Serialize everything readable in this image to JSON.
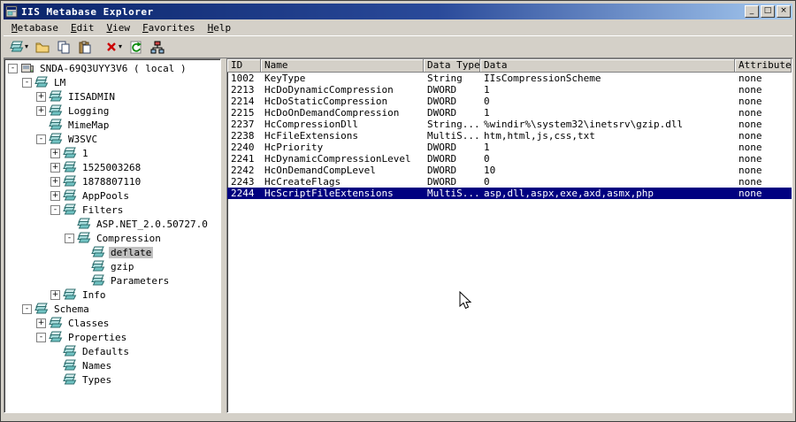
{
  "window": {
    "title": "IIS Metabase Explorer",
    "controls": {
      "minimize": "_",
      "maximize": "□",
      "close": "×"
    }
  },
  "menu": {
    "items": [
      "Metabase",
      "Edit",
      "View",
      "Favorites",
      "Help"
    ]
  },
  "toolbar": {
    "dropdown_glyph": "▾",
    "buttons": [
      "new-key",
      "open",
      "copy",
      "paste",
      "delete",
      "refresh",
      "network"
    ]
  },
  "tree": {
    "items": [
      {
        "label": "SNDA-69Q3UYY3V6 ( local )",
        "depth": 0,
        "expand": "minus",
        "icon": "server",
        "selected": false
      },
      {
        "label": "LM",
        "depth": 1,
        "expand": "minus",
        "icon": "keys",
        "selected": false
      },
      {
        "label": "IISADMIN",
        "depth": 2,
        "expand": "plus",
        "icon": "keys",
        "selected": false
      },
      {
        "label": "Logging",
        "depth": 2,
        "expand": "plus",
        "icon": "keys",
        "selected": false
      },
      {
        "label": "MimeMap",
        "depth": 2,
        "expand": "none",
        "icon": "keys",
        "selected": false
      },
      {
        "label": "W3SVC",
        "depth": 2,
        "expand": "minus",
        "icon": "keys",
        "selected": false
      },
      {
        "label": "1",
        "depth": 3,
        "expand": "plus",
        "icon": "keys",
        "selected": false
      },
      {
        "label": "1525003268",
        "depth": 3,
        "expand": "plus",
        "icon": "keys",
        "selected": false
      },
      {
        "label": "1878807110",
        "depth": 3,
        "expand": "plus",
        "icon": "keys",
        "selected": false
      },
      {
        "label": "AppPools",
        "depth": 3,
        "expand": "plus",
        "icon": "keys",
        "selected": false
      },
      {
        "label": "Filters",
        "depth": 3,
        "expand": "minus",
        "icon": "keys",
        "selected": false
      },
      {
        "label": "ASP.NET_2.0.50727.0",
        "depth": 4,
        "expand": "none",
        "icon": "keys",
        "selected": false
      },
      {
        "label": "Compression",
        "depth": 4,
        "expand": "minus",
        "icon": "keys",
        "selected": false
      },
      {
        "label": "deflate",
        "depth": 5,
        "expand": "none",
        "icon": "keys",
        "selected": true
      },
      {
        "label": "gzip",
        "depth": 5,
        "expand": "none",
        "icon": "keys",
        "selected": false
      },
      {
        "label": "Parameters",
        "depth": 5,
        "expand": "none",
        "icon": "keys",
        "selected": false
      },
      {
        "label": "Info",
        "depth": 3,
        "expand": "plus",
        "icon": "keys",
        "selected": false
      },
      {
        "label": "Schema",
        "depth": 1,
        "expand": "minus",
        "icon": "keys",
        "selected": false
      },
      {
        "label": "Classes",
        "depth": 2,
        "expand": "plus",
        "icon": "keys",
        "selected": false
      },
      {
        "label": "Properties",
        "depth": 2,
        "expand": "minus",
        "icon": "keys",
        "selected": false
      },
      {
        "label": "Defaults",
        "depth": 3,
        "expand": "none",
        "icon": "keys",
        "selected": false
      },
      {
        "label": "Names",
        "depth": 3,
        "expand": "none",
        "icon": "keys",
        "selected": false
      },
      {
        "label": "Types",
        "depth": 3,
        "expand": "none",
        "icon": "keys",
        "selected": false
      }
    ]
  },
  "table": {
    "columns": [
      "ID",
      "Name",
      "Data Type",
      "Data",
      "Attributes"
    ],
    "rows": [
      {
        "id": "1002",
        "name": "KeyType",
        "type": "String",
        "data": "IIsCompressionScheme",
        "attributes": "none",
        "selected": false
      },
      {
        "id": "2213",
        "name": "HcDoDynamicCompression",
        "type": "DWORD",
        "data": "1",
        "attributes": "none",
        "selected": false
      },
      {
        "id": "2214",
        "name": "HcDoStaticCompression",
        "type": "DWORD",
        "data": "0",
        "attributes": "none",
        "selected": false
      },
      {
        "id": "2215",
        "name": "HcDoOnDemandCompression",
        "type": "DWORD",
        "data": "1",
        "attributes": "none",
        "selected": false
      },
      {
        "id": "2237",
        "name": "HcCompressionDll",
        "type": "String...",
        "data": "%windir%\\system32\\inetsrv\\gzip.dll",
        "attributes": "none",
        "selected": false
      },
      {
        "id": "2238",
        "name": "HcFileExtensions",
        "type": "MultiS...",
        "data": "htm,html,js,css,txt",
        "attributes": "none",
        "selected": false
      },
      {
        "id": "2240",
        "name": "HcPriority",
        "type": "DWORD",
        "data": "1",
        "attributes": "none",
        "selected": false
      },
      {
        "id": "2241",
        "name": "HcDynamicCompressionLevel",
        "type": "DWORD",
        "data": "0",
        "attributes": "none",
        "selected": false
      },
      {
        "id": "2242",
        "name": "HcOnDemandCompLevel",
        "type": "DWORD",
        "data": "10",
        "attributes": "none",
        "selected": false
      },
      {
        "id": "2243",
        "name": "HcCreateFlags",
        "type": "DWORD",
        "data": "0",
        "attributes": "none",
        "selected": false
      },
      {
        "id": "2244",
        "name": "HcScriptFileExtensions",
        "type": "MultiS...",
        "data": "asp,dll,aspx,exe,axd,asmx,php",
        "attributes": "none",
        "selected": true
      }
    ]
  },
  "colors": {
    "titlebar_left": "#0a246a",
    "titlebar_right": "#a6caf0",
    "selection": "#000080",
    "chrome": "#d4d0c8"
  }
}
